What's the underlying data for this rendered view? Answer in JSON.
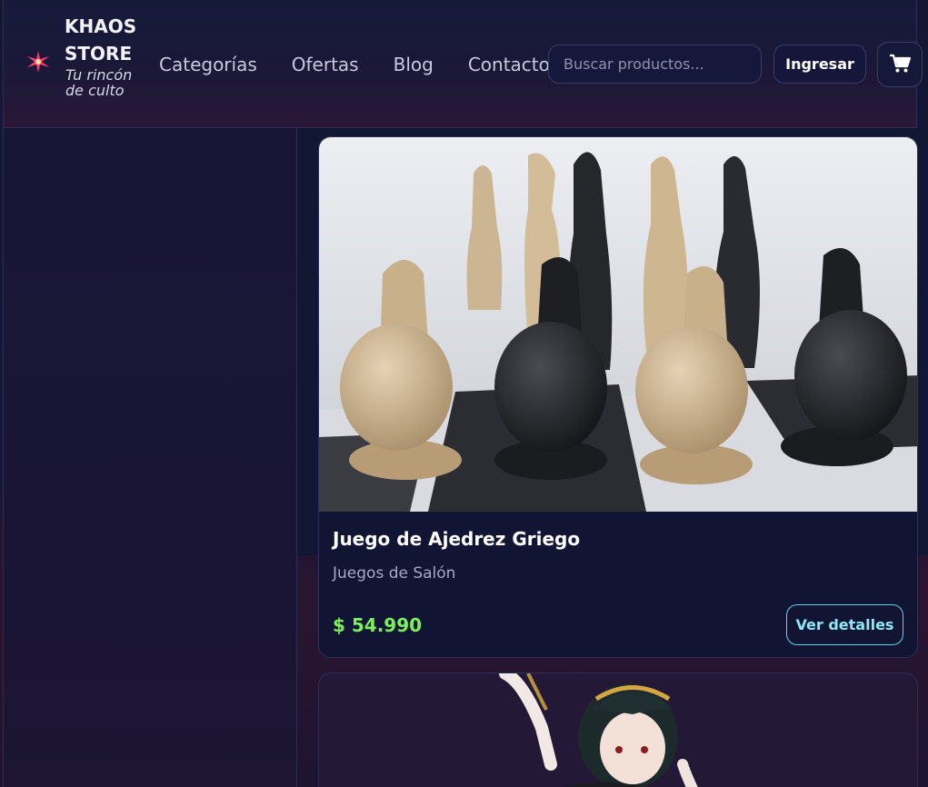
{
  "brand": {
    "name": "KHAOS STORE",
    "tagline": "Tu rincón de culto",
    "icon": "starburst-icon",
    "accent_color": "#ff3c6e"
  },
  "nav": {
    "items": [
      {
        "label": "Categorías"
      },
      {
        "label": "Ofertas"
      },
      {
        "label": "Blog"
      },
      {
        "label": "Contacto"
      }
    ]
  },
  "search": {
    "placeholder": "Buscar productos...",
    "value": ""
  },
  "header_actions": {
    "login_label": "Ingresar",
    "cart_icon": "shopping-cart-icon"
  },
  "products": [
    {
      "title": "Juego de Ajedrez Griego",
      "category": "Juegos de Salón",
      "price": "$ 54.990",
      "details_label": "Ver detalles",
      "image": "greek-chess-pieces-photo"
    },
    {
      "image": "anime-figure-photo"
    }
  ],
  "colors": {
    "background": "#141633",
    "card": "#111433",
    "price": "#7bf05a",
    "details_border": "#55d6ec"
  }
}
